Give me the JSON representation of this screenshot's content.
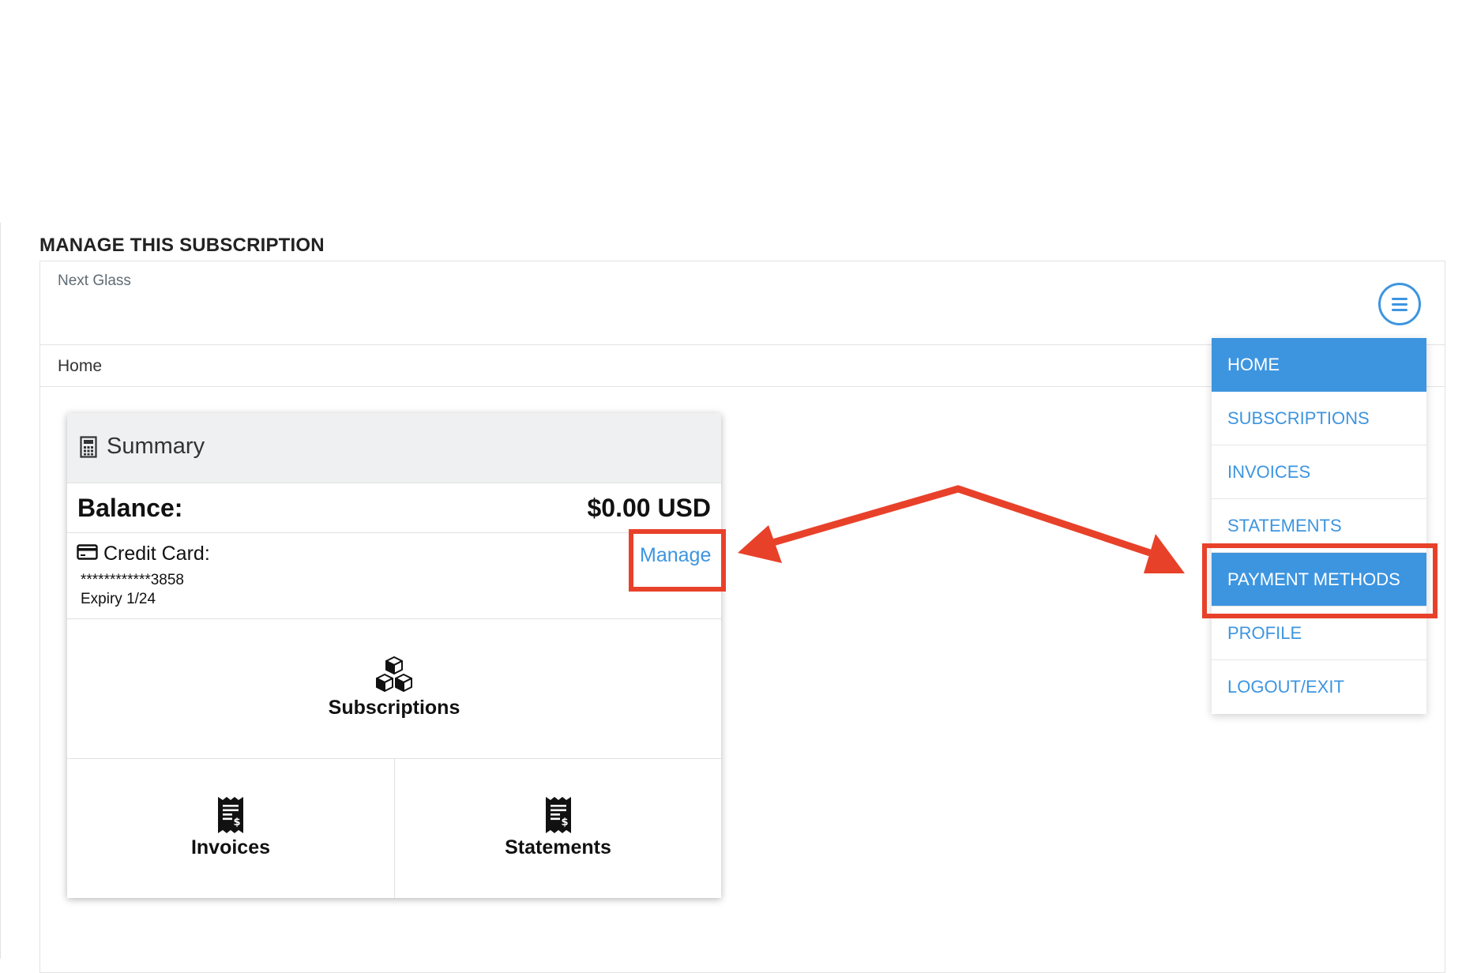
{
  "section_title": "MANAGE THIS SUBSCRIPTION",
  "company_name": "Next Glass",
  "breadcrumb": "Home",
  "menu": {
    "items": [
      {
        "label": "HOME"
      },
      {
        "label": "SUBSCRIPTIONS"
      },
      {
        "label": "INVOICES"
      },
      {
        "label": "STATEMENTS"
      },
      {
        "label": "PAYMENT METHODS"
      },
      {
        "label": "PROFILE"
      },
      {
        "label": "LOGOUT/EXIT"
      }
    ],
    "active_index": 0,
    "highlighted_index": 4
  },
  "summary": {
    "title": "Summary",
    "balance_label": "Balance:",
    "balance_value": "$0.00 USD",
    "credit_card": {
      "label": "Credit Card:",
      "number": "************3858",
      "expiry": "Expiry 1/24",
      "manage_label": "Manage"
    },
    "tiles": {
      "subscriptions": "Subscriptions",
      "invoices": "Invoices",
      "statements": "Statements"
    }
  },
  "icons": {
    "menu": "hamburger-menu-icon",
    "summary": "calculator-icon",
    "card": "credit-card-icon",
    "subscriptions": "cubes-icon",
    "invoices": "receipt-icon",
    "statements": "receipt-icon"
  },
  "colors": {
    "accent": "#3d95e0",
    "annotation": "#e8412a",
    "header_bg": "#eff0f1"
  }
}
